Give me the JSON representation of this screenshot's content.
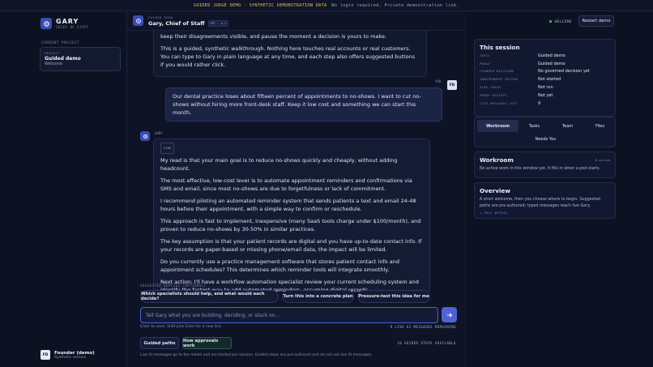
{
  "banner": {
    "label": "GUIDED JUDGE DEMO · SYNTHETIC DEMONSTRATION DATA",
    "note": "No login required. Private demonstration link."
  },
  "sidebar": {
    "brand_name": "GARY",
    "brand_sub": "CHIEF OF STAFF",
    "section_label": "CURRENT PROJECT",
    "project": {
      "label": "PROJECT",
      "title": "Guided demo",
      "subtitle": "Welcome"
    },
    "user": {
      "initials": "FD",
      "name": "Founder (demo)",
      "subtitle": "Synthetic session"
    }
  },
  "header": {
    "mini_label": "GUIDED DEMO",
    "title": "Gary, Chief of Staff",
    "model_badge": "GPT · 4.1"
  },
  "chat": {
    "intro": [
      "keep their disagreements visible, and pause the moment a decision is yours to make.",
      "This is a guided, synthetic walkthrough. Nothing here touches real accounts or real customers. You can type to Gary in plain language at any time, and each step also offers suggested buttons if you would rather click."
    ],
    "you_label": "YOU",
    "you_initials": "FD",
    "user_message": "Our dental practice loses about fifteen percent of appointments to no-shows. I want to cut no-shows without hiring more front-desk staff. Keep it low cost and something we can start this month.",
    "gary_label": "GARY",
    "live_badge": "LIVE",
    "reply": [
      "My read is that your main goal is to reduce no-shows quickly and cheaply, without adding headcount.",
      "The most effective, low-cost lever is to automate appointment reminders and confirmations via SMS and email, since most no-shows are due to forgetfulness or lack of commitment.",
      "I recommend piloting an automated reminder system that sends patients a text and email 24-48 hours before their appointment, with a simple way to confirm or reschedule.",
      "This approach is fast to implement, inexpensive (many SaaS tools charge under $100/month), and proven to reduce no-shows by 30-50% in similar practices.",
      "The key assumption is that your patient records are digital and you have up-to-date contact info. If your records are paper-based or missing phone/email data, the impact will be limited.",
      "Do you currently use a practice management software that stores patient contact info and appointment schedules? This determines which reminder tools will integrate smoothly.",
      "Next action: I'll have a workflow automation specialist review your current scheduling system and identify the fastest way to add automated reminders, assuming digital records."
    ]
  },
  "suggestions": {
    "label": "SUGGESTED REPLIES (OPTIONAL)",
    "chips": [
      "Which specialists should help, and what would each decide?",
      "Turn this into a concrete plan",
      "Pressure-test this idea for me"
    ]
  },
  "composer": {
    "placeholder": "Tell Gary what you are building, deciding, or stuck on...",
    "hint": "Enter to send. Shift plus Enter for a new line.",
    "remaining": "9 LIVE AI MESSAGES REMAINING"
  },
  "footer": {
    "guided_paths": "Guided paths",
    "approvals": "How approvals work",
    "guided_steps": "10 GUIDED STEPS AVAILABLE",
    "footnote": "Live AI messages go to the model and are limited per session. Guided steps are pre-authored and do not use live AI messages."
  },
  "right": {
    "status": "WELCOME",
    "restart": "Restart demo",
    "session": {
      "title": "This session",
      "rows": [
        {
          "k": "TOPIC",
          "v": "Guided demo"
        },
        {
          "k": "PHASE",
          "v": "Guided demo"
        },
        {
          "k": "FOUNDER DECISION",
          "v": "No governed decision yet"
        },
        {
          "k": "INDEPENDENT REVIEW",
          "v": "Not started"
        },
        {
          "k": "VIBE CHECK",
          "v": "Not run"
        },
        {
          "k": "PROOF RECEIPT",
          "v": "Not yet"
        },
        {
          "k": "LIVE MESSAGES LEFT",
          "v": "9"
        }
      ]
    },
    "tabs": [
      "Workroom",
      "Tasks",
      "Team",
      "Files",
      "Needs You"
    ],
    "workroom": {
      "title": "Workroom",
      "count": "0 active",
      "text": "No active work in this window yet. It fills in when a pod starts."
    },
    "overview": {
      "title": "Overview",
      "text": "A short welcome, then you choose where to begin. Suggested paths are pre-authored; typed messages reach live Gary.",
      "link": "+ FULL DETAIL"
    }
  },
  "colors": {
    "accent": "#5062d6",
    "live_dot": "#33c48a",
    "background": "#0c1020"
  }
}
